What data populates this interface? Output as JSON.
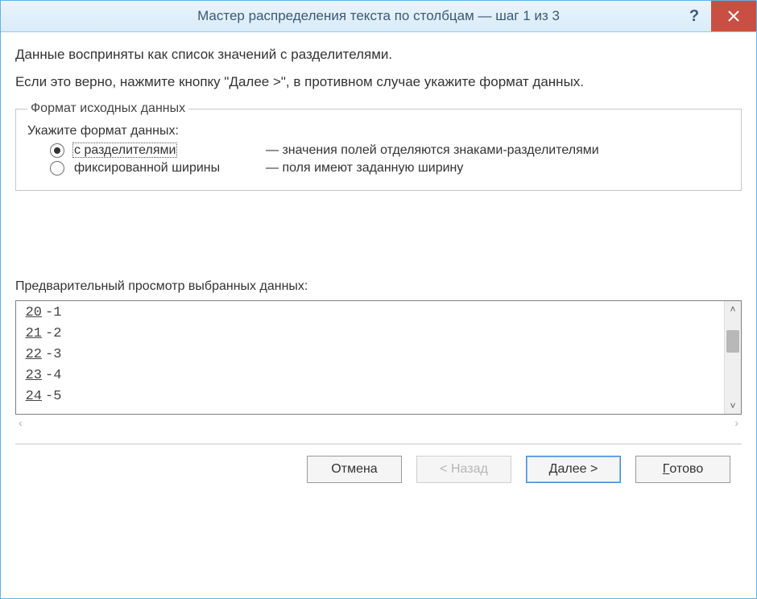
{
  "title": "Мастер распределения текста по столбцам — шаг 1 из 3",
  "intro_line1": "Данные восприняты как список значений с разделителями.",
  "intro_line2": "Если это верно, нажмите кнопку \"Далее >\", в противном случае укажите формат данных.",
  "fieldset_legend": "Формат исходных данных",
  "format_prompt": "Укажите формат данных:",
  "radios": [
    {
      "label": "с разделителями",
      "desc": "— значения полей отделяются знаками-разделителями",
      "selected": true
    },
    {
      "label": "фиксированной ширины",
      "desc": "— поля имеют заданную ширину",
      "selected": false
    }
  ],
  "preview_label": "Предварительный просмотр выбранных данных:",
  "preview_rows": [
    {
      "n": "20",
      "v": "-1"
    },
    {
      "n": "21",
      "v": "-2"
    },
    {
      "n": "22",
      "v": "-3"
    },
    {
      "n": "23",
      "v": "-4"
    },
    {
      "n": "24",
      "v": "-5"
    }
  ],
  "buttons": {
    "cancel": "Отмена",
    "back_full": "< Назад",
    "next_full": "Далее >",
    "next_access": "Д",
    "next_rest": "алее >",
    "finish_full": "Готово",
    "finish_access": "Г",
    "finish_rest": "отово"
  },
  "help_symbol": "?",
  "scroll": {
    "up": "˄",
    "down": "˅",
    "left": "‹",
    "right": "›"
  }
}
